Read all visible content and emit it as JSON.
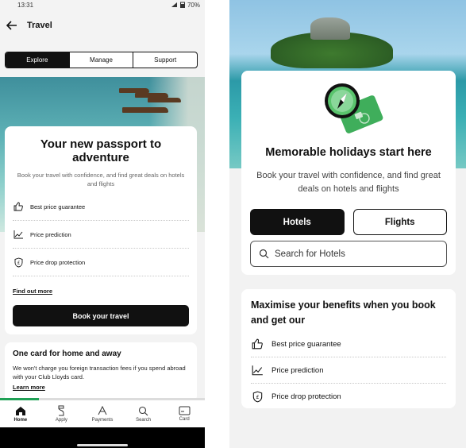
{
  "left": {
    "status": {
      "time": "13:31",
      "battery": "70%"
    },
    "header": {
      "title": "Travel"
    },
    "segments": [
      {
        "label": "Explore",
        "active": true
      },
      {
        "label": "Manage",
        "active": false
      },
      {
        "label": "Support",
        "active": false
      }
    ],
    "main_card": {
      "title": "Your new passport to adventure",
      "subtitle": "Book your travel with confidence, and find great deals on hotels and flights",
      "features": [
        {
          "icon": "thumbs-up-icon",
          "label": "Best price guarantee"
        },
        {
          "icon": "trend-chart-icon",
          "label": "Price prediction"
        },
        {
          "icon": "pound-shield-icon",
          "label": "Price drop protection"
        }
      ],
      "find_out_more": "Find out more",
      "cta": "Book your travel"
    },
    "card_two": {
      "title": "One card for home and away",
      "body": "We won't charge you foreign transaction fees if you spend abroad with your Club Lloyds card.",
      "link": "Learn more"
    },
    "progress": 0.19,
    "nav": [
      {
        "label": "Home",
        "icon": "home-icon",
        "active": true
      },
      {
        "label": "Apply",
        "icon": "apply-icon",
        "active": false
      },
      {
        "label": "Payments",
        "icon": "payments-icon",
        "active": false
      },
      {
        "label": "Search",
        "icon": "search-icon",
        "active": false
      },
      {
        "label": "Card",
        "icon": "card-icon",
        "active": false
      }
    ]
  },
  "right": {
    "main_card": {
      "title": "Memorable holidays start here",
      "subtitle": "Book your travel with confidence, and find great deals on hotels and flights",
      "tabs": [
        {
          "label": "Hotels",
          "active": true
        },
        {
          "label": "Flights",
          "active": false
        }
      ],
      "search_placeholder": "Search for Hotels"
    },
    "benefits_card": {
      "title": "Maximise your benefits when you book and get our",
      "features": [
        {
          "icon": "thumbs-up-icon",
          "label": "Best price guarantee"
        },
        {
          "icon": "trend-chart-icon",
          "label": "Price prediction"
        },
        {
          "icon": "pound-shield-icon",
          "label": "Price drop protection"
        }
      ]
    }
  },
  "colors": {
    "brand_green": "#1fa055",
    "primary_dark": "#111111"
  }
}
